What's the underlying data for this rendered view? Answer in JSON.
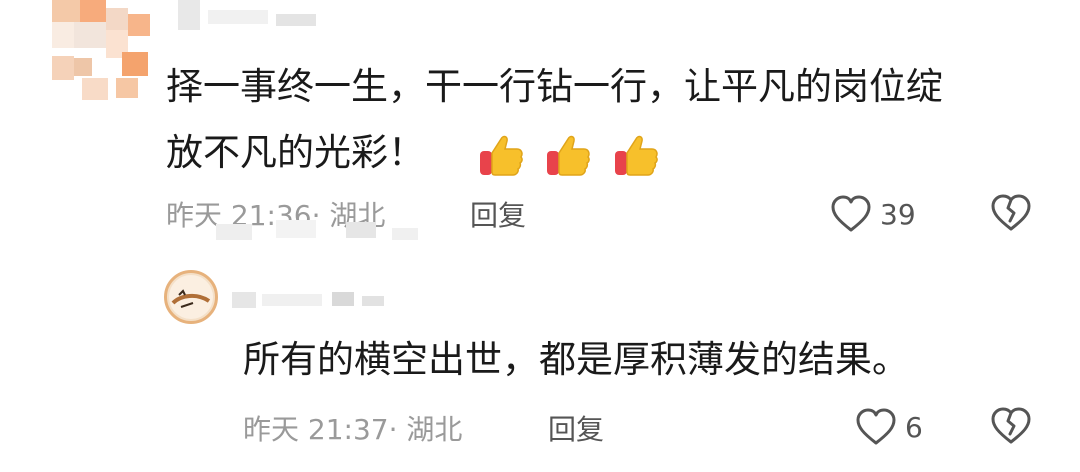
{
  "comments": [
    {
      "text_line1": "择一事终一生，干一行钻一行，让平凡的岗位绽",
      "text_line2": "放不凡的光彩！",
      "emoji": [
        "thumbs-up-icon",
        "thumbs-up-icon",
        "thumbs-up-icon"
      ],
      "time": "昨天 21:36",
      "location": "· 湖北",
      "reply_label": "回复",
      "like_count": "39"
    },
    {
      "text": "所有的横空出世，都是厚积薄发的结果。",
      "time": "昨天 21:37",
      "location": "· 湖北",
      "reply_label": "回复",
      "like_count": "6"
    }
  ],
  "colors": {
    "meta": "#9a9a9a",
    "text": "#1a1a1a",
    "icon": "#555555",
    "thumb_yellow": "#f7c02b",
    "thumb_red": "#e8434b"
  }
}
